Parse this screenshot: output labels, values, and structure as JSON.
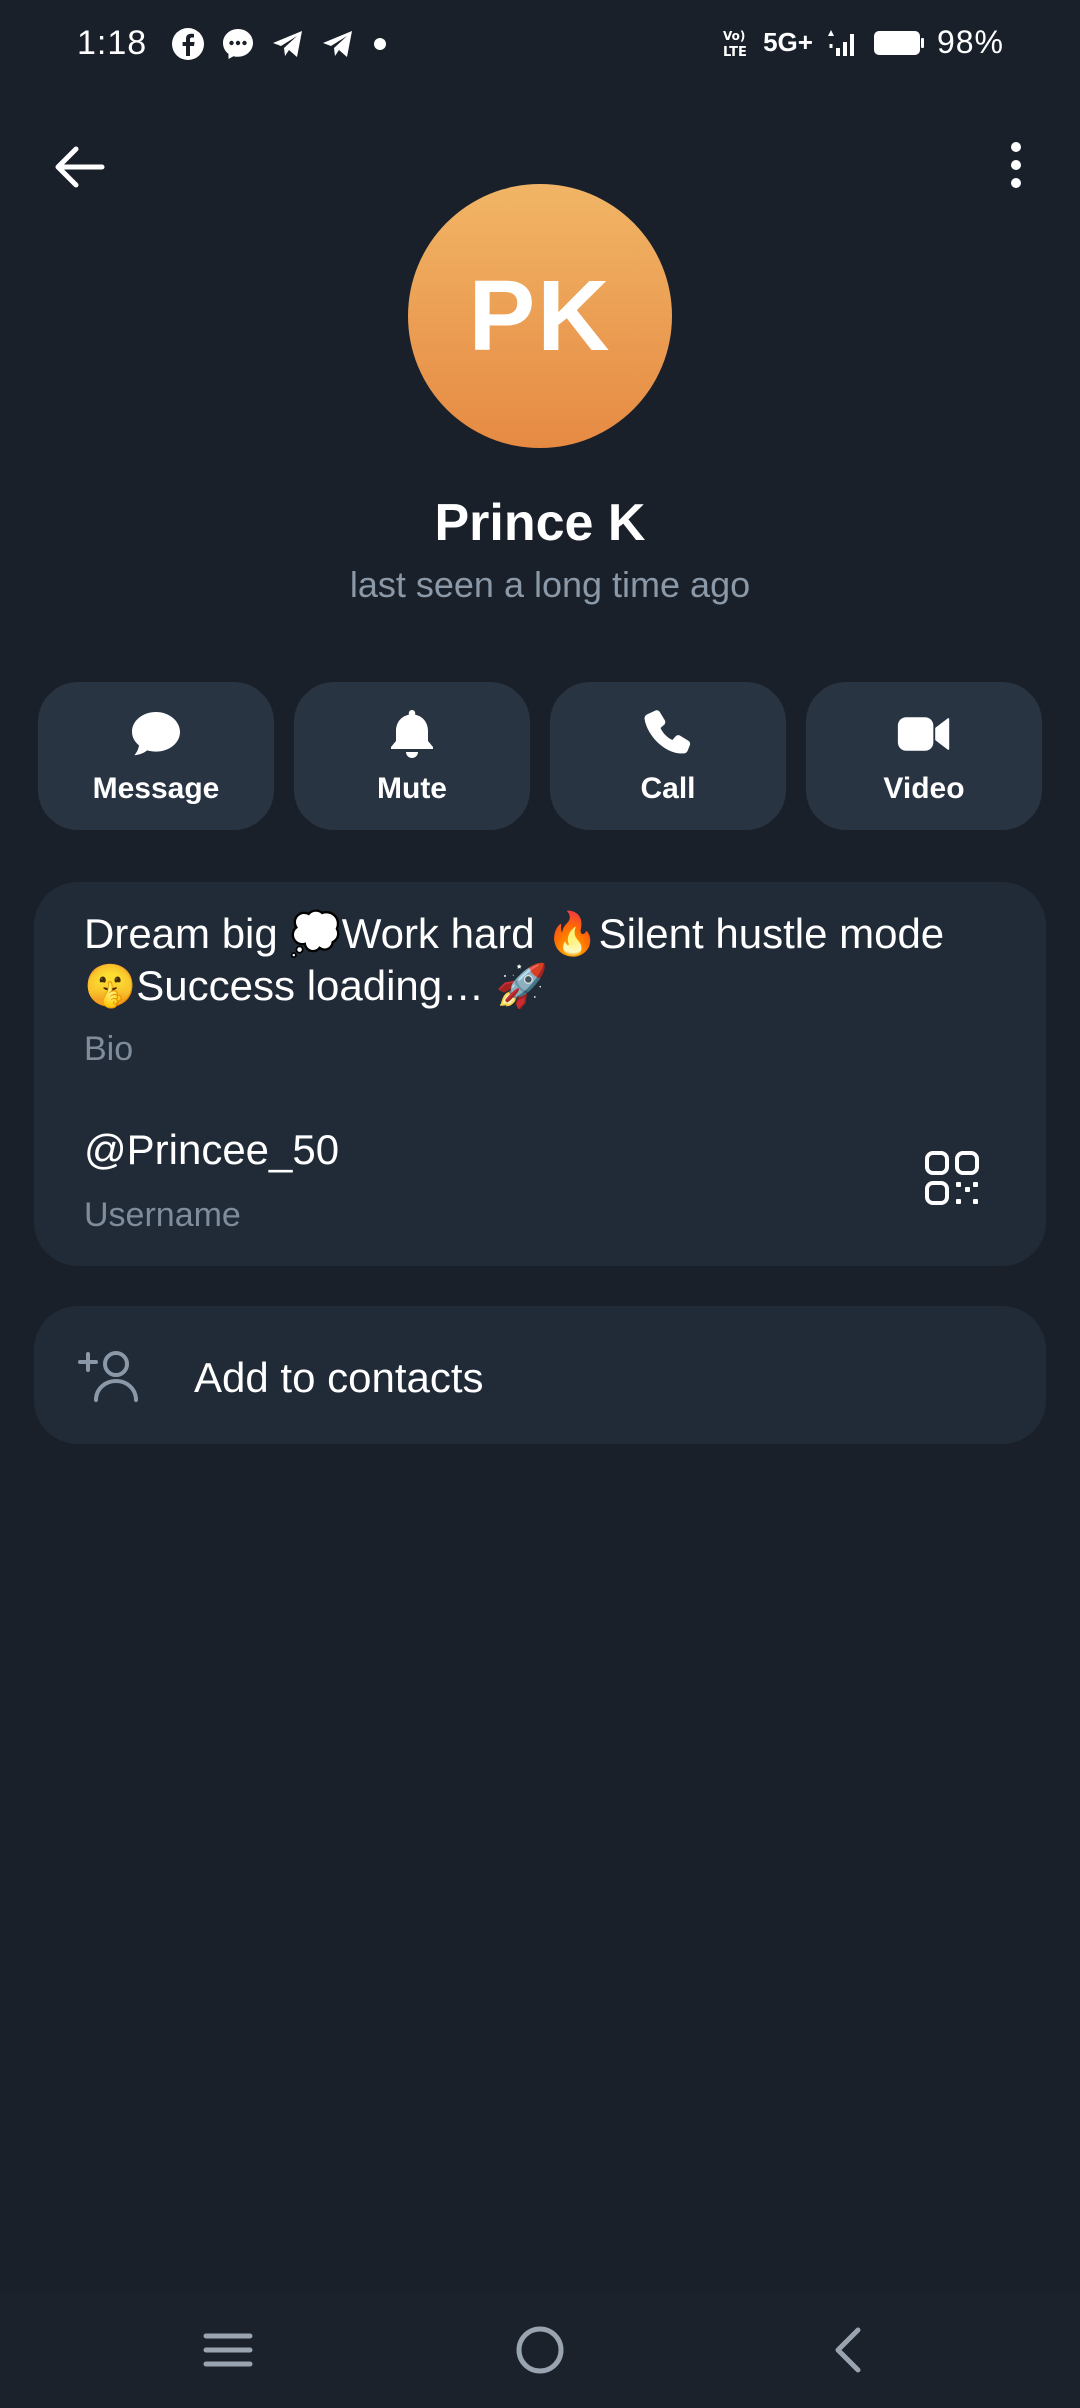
{
  "status_bar": {
    "time": "1:18",
    "network_label": "5G+",
    "battery_text": "98%",
    "notification_icons": [
      "facebook-icon",
      "messenger-icon",
      "telegram-icon",
      "telegram-icon",
      "dot-icon"
    ]
  },
  "profile": {
    "initials": "PK",
    "name": "Prince K",
    "status": "last seen a long time ago",
    "avatar_colors": [
      "#f1b566",
      "#e68a43"
    ]
  },
  "actions": [
    {
      "label": "Message",
      "icon": "chat-bubble-icon"
    },
    {
      "label": "Mute",
      "icon": "bell-icon"
    },
    {
      "label": "Call",
      "icon": "phone-icon"
    },
    {
      "label": "Video",
      "icon": "video-camera-icon"
    }
  ],
  "info": {
    "bio": "Dream big 💭Work hard 🔥Silent hustle mode 🤫Success loading… 🚀",
    "bio_label": "Bio",
    "username": "@Princee_50",
    "username_label": "Username"
  },
  "add_contact": {
    "label": "Add to contacts",
    "icon": "add-person-icon"
  },
  "colors": {
    "background": "#19202a",
    "card": "#212b37",
    "action_button": "#283442",
    "secondary_text": "#7e8c9c"
  }
}
